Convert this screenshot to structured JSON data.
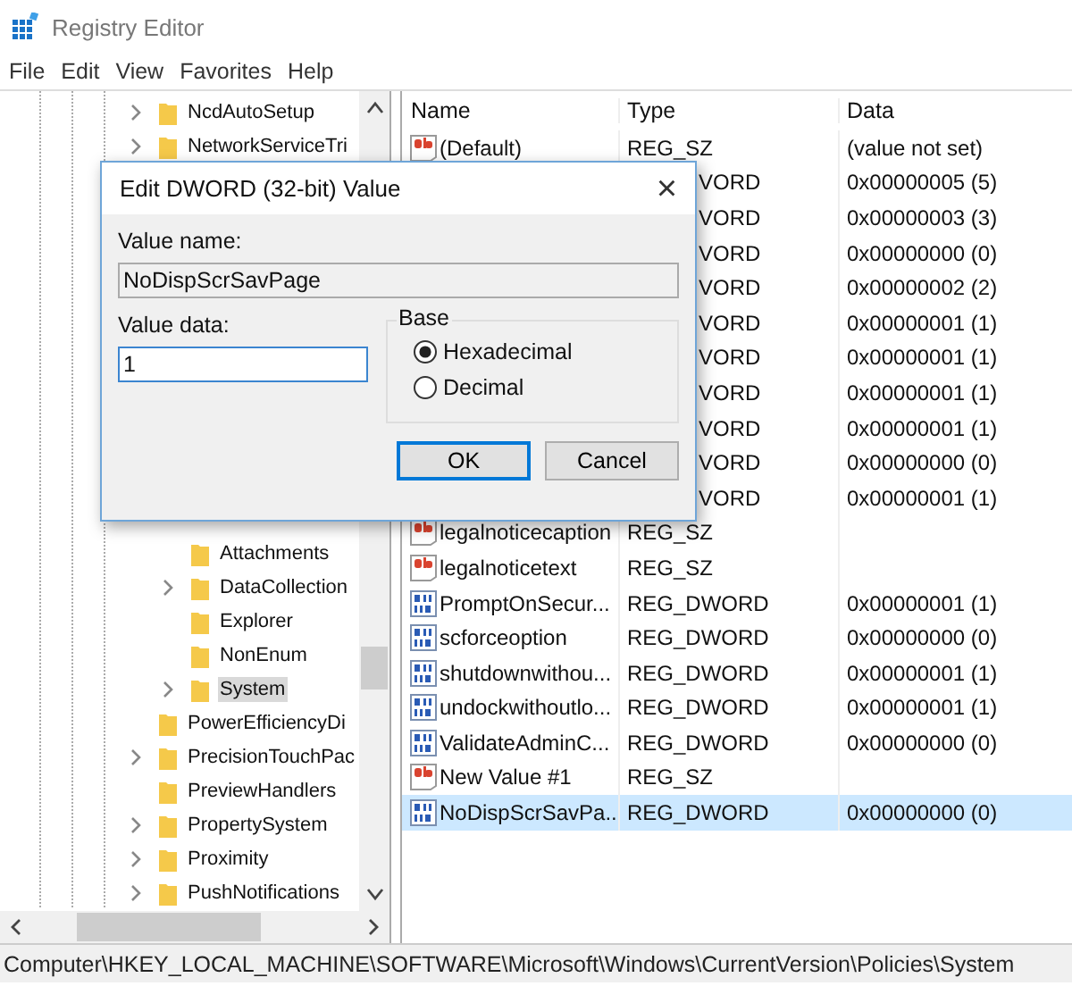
{
  "window": {
    "title": "Registry Editor"
  },
  "menu": [
    "File",
    "Edit",
    "View",
    "Favorites",
    "Help"
  ],
  "tree": {
    "upper": [
      {
        "label": "NcdAutoSetup",
        "expandable": true,
        "selected": false
      },
      {
        "label": "NetworkServiceTri",
        "expandable": true,
        "selected": false
      }
    ],
    "inner": [
      {
        "label": "Attachments",
        "expandable": false,
        "selected": false
      },
      {
        "label": "DataCollection",
        "expandable": true,
        "selected": false
      },
      {
        "label": "Explorer",
        "expandable": false,
        "selected": false
      },
      {
        "label": "NonEnum",
        "expandable": false,
        "selected": false
      },
      {
        "label": "System",
        "expandable": true,
        "selected": true
      }
    ],
    "lower": [
      {
        "label": "PowerEfficiencyDi",
        "expandable": false,
        "selected": false
      },
      {
        "label": "PrecisionTouchPac",
        "expandable": true,
        "selected": false
      },
      {
        "label": "PreviewHandlers",
        "expandable": false,
        "selected": false
      },
      {
        "label": "PropertySystem",
        "expandable": true,
        "selected": false
      },
      {
        "label": "Proximity",
        "expandable": true,
        "selected": false
      },
      {
        "label": "PushNotifications",
        "expandable": true,
        "selected": false
      }
    ]
  },
  "table": {
    "columns": [
      "Name",
      "Type",
      "Data"
    ],
    "rows": [
      {
        "kind": "string",
        "name": "(Default)",
        "type": "REG_SZ",
        "data": "(value not set)",
        "selected": false
      },
      {
        "kind": "covered",
        "type": "VORD",
        "data": "0x00000005 (5)",
        "selected": false
      },
      {
        "kind": "covered",
        "type": "VORD",
        "data": "0x00000003 (3)",
        "selected": false
      },
      {
        "kind": "covered",
        "type": "VORD",
        "data": "0x00000000 (0)",
        "selected": false
      },
      {
        "kind": "covered",
        "type": "VORD",
        "data": "0x00000002 (2)",
        "selected": false
      },
      {
        "kind": "covered",
        "type": "VORD",
        "data": "0x00000001 (1)",
        "selected": false
      },
      {
        "kind": "covered",
        "type": "VORD",
        "data": "0x00000001 (1)",
        "selected": false
      },
      {
        "kind": "covered",
        "type": "VORD",
        "data": "0x00000001 (1)",
        "selected": false
      },
      {
        "kind": "covered",
        "type": "VORD",
        "data": "0x00000001 (1)",
        "selected": false
      },
      {
        "kind": "covered",
        "type": "VORD",
        "data": "0x00000000 (0)",
        "selected": false
      },
      {
        "kind": "covered",
        "type": "VORD",
        "data": "0x00000001 (1)",
        "selected": false
      },
      {
        "kind": "string",
        "name": "legalnoticecaption",
        "type": "REG_SZ",
        "selected": false
      },
      {
        "kind": "string",
        "name": "legalnoticetext",
        "type": "REG_SZ",
        "selected": false
      },
      {
        "kind": "dword",
        "name": "PromptOnSecur...",
        "type": "REG_DWORD",
        "data": "0x00000001 (1)",
        "selected": false
      },
      {
        "kind": "dword",
        "name": "scforceoption",
        "type": "REG_DWORD",
        "data": "0x00000000 (0)",
        "selected": false
      },
      {
        "kind": "dword",
        "name": "shutdownwithou...",
        "type": "REG_DWORD",
        "data": "0x00000001 (1)",
        "selected": false
      },
      {
        "kind": "dword",
        "name": "undockwithoutlo...",
        "type": "REG_DWORD",
        "data": "0x00000001 (1)",
        "selected": false
      },
      {
        "kind": "dword",
        "name": "ValidateAdminC...",
        "type": "REG_DWORD",
        "data": "0x00000000 (0)",
        "selected": false
      },
      {
        "kind": "string",
        "name": "New Value #1",
        "type": "REG_SZ",
        "selected": false
      },
      {
        "kind": "dword",
        "name": "NoDispScrSavPa...",
        "type": "REG_DWORD",
        "data": "0x00000000 (0)",
        "selected": true
      }
    ]
  },
  "status_bar": "Computer\\HKEY_LOCAL_MACHINE\\SOFTWARE\\Microsoft\\Windows\\CurrentVersion\\Policies\\System",
  "dialog": {
    "title": "Edit DWORD (32-bit) Value",
    "close": "×",
    "value_name_label": "Value name:",
    "value_name": "NoDispScrSavPage",
    "value_data_label": "Value data:",
    "value_data": "1",
    "base_label": "Base",
    "bases": [
      {
        "label": "Hexadecimal",
        "selected": true
      },
      {
        "label": "Decimal",
        "selected": false
      }
    ],
    "buttons": [
      {
        "label": "OK",
        "focused": true
      },
      {
        "label": "Cancel",
        "focused": false
      }
    ]
  }
}
